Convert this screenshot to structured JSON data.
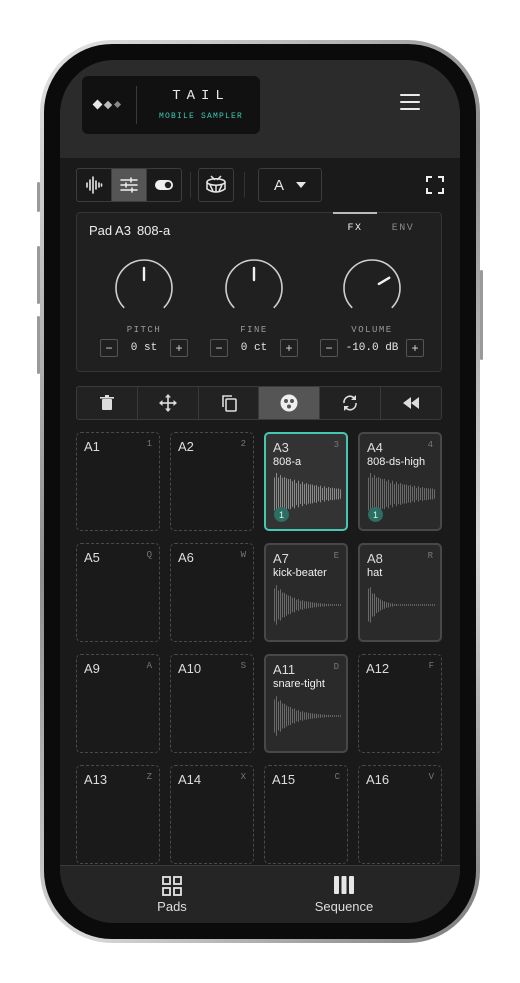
{
  "app": {
    "logo_title": "TAIL",
    "logo_subtitle": "MOBILE SAMPLER",
    "menu_icon": "hamburger-icon",
    "accent_color": "#40c9b4"
  },
  "toolbar": {
    "mode_icons": [
      "waveform-icon",
      "sliders-icon",
      "toggle-icon"
    ],
    "active_mode": 1,
    "drum_icon": "drum-icon",
    "bank_select": "A",
    "fullscreen_icon": "expand-icon"
  },
  "panel": {
    "pad_label": "Pad A3",
    "sample_name": "808-a",
    "tabs": [
      "FX",
      "ENV"
    ],
    "active_tab": "FX",
    "knobs": [
      {
        "label": "PITCH",
        "value": "0 st",
        "level": 0.5
      },
      {
        "label": "FINE",
        "value": "0 ct",
        "level": 0.5
      },
      {
        "label": "VOLUME",
        "value": "-10.0 dB",
        "level": 0.72
      }
    ],
    "minus": "−",
    "plus": "+"
  },
  "actions": {
    "icons": [
      "trash-icon",
      "move-icon",
      "copy-icon",
      "choke-group-icon",
      "loop-icon",
      "rewind-icon"
    ],
    "active": 3
  },
  "pads": [
    {
      "id": "A1",
      "key": "1",
      "sample": "",
      "count": ""
    },
    {
      "id": "A2",
      "key": "2",
      "sample": "",
      "count": ""
    },
    {
      "id": "A3",
      "key": "3",
      "sample": "808-a",
      "count": "1",
      "selected": true
    },
    {
      "id": "A4",
      "key": "4",
      "sample": "808-ds-high",
      "count": "1"
    },
    {
      "id": "A5",
      "key": "Q",
      "sample": "",
      "count": ""
    },
    {
      "id": "A6",
      "key": "W",
      "sample": "",
      "count": ""
    },
    {
      "id": "A7",
      "key": "E",
      "sample": "kick-beater",
      "count": ""
    },
    {
      "id": "A8",
      "key": "R",
      "sample": "hat",
      "count": ""
    },
    {
      "id": "A9",
      "key": "A",
      "sample": "",
      "count": ""
    },
    {
      "id": "A10",
      "key": "S",
      "sample": "",
      "count": ""
    },
    {
      "id": "A11",
      "key": "D",
      "sample": "snare-tight",
      "count": ""
    },
    {
      "id": "A12",
      "key": "F",
      "sample": "",
      "count": ""
    },
    {
      "id": "A13",
      "key": "Z",
      "sample": "",
      "count": ""
    },
    {
      "id": "A14",
      "key": "X",
      "sample": "",
      "count": ""
    },
    {
      "id": "A15",
      "key": "C",
      "sample": "",
      "count": ""
    },
    {
      "id": "A16",
      "key": "V",
      "sample": "",
      "count": ""
    }
  ],
  "nav": {
    "pads_label": "Pads",
    "pads_icon": "grid-icon",
    "sequence_label": "Sequence",
    "sequence_icon": "bars-icon"
  }
}
